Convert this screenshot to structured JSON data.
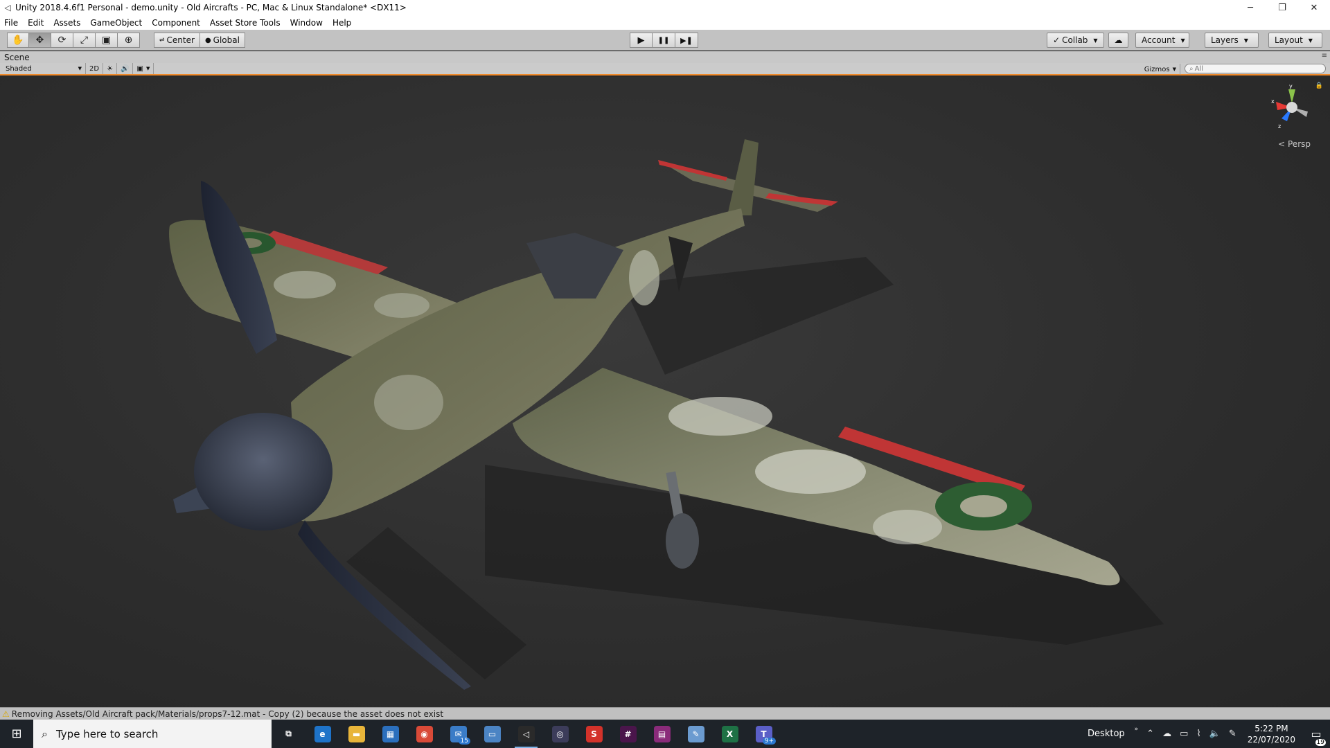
{
  "window": {
    "title": "Unity 2018.4.6f1 Personal - demo.unity - Old Aircrafts - PC, Mac & Linux Standalone* <DX11>",
    "controls": [
      "─",
      "❐",
      "✕"
    ]
  },
  "menubar": {
    "items": [
      "File",
      "Edit",
      "Assets",
      "GameObject",
      "Component",
      "Asset Store Tools",
      "Window",
      "Help"
    ]
  },
  "toolbar": {
    "tools": [
      {
        "name": "hand-tool",
        "glyph": "✋"
      },
      {
        "name": "move-tool",
        "glyph": "✥"
      },
      {
        "name": "rotate-tool",
        "glyph": "⟳"
      },
      {
        "name": "scale-tool",
        "glyph": "⤢"
      },
      {
        "name": "rect-tool",
        "glyph": "▣"
      },
      {
        "name": "transform-tool",
        "glyph": "⊕"
      }
    ],
    "pivot_label": "Center",
    "space_label": "Global",
    "play_glyph": "▶",
    "pause_glyph": "❚❚",
    "step_glyph": "▶❚",
    "collab_label": "Collab",
    "account_label": "Account",
    "layers_label": "Layers",
    "layout_label": "Layout"
  },
  "scene": {
    "tab_label": "Scene",
    "draw_mode": "Shaded",
    "mode_2d": "2D",
    "gizmos_label": "Gizmos",
    "search_placeholder": "All",
    "persp_label": "Persp",
    "axis_y": "y",
    "axis_x": "x",
    "axis_z": "z"
  },
  "status": {
    "message": "Removing Assets/Old Aircraft pack/Materials/props7-12.mat - Copy (2) because the asset does not exist"
  },
  "taskbar": {
    "search_placeholder": "Type here to search",
    "apps": [
      {
        "name": "task-view-icon",
        "glyph": "⧉",
        "color": "transparent",
        "running": false
      },
      {
        "name": "edge-icon",
        "glyph": "e",
        "color": "#1e73c8",
        "running": false
      },
      {
        "name": "file-explorer-icon",
        "glyph": "▬",
        "color": "#e8b53a",
        "running": false
      },
      {
        "name": "store-icon",
        "glyph": "▦",
        "color": "#2b6fbd",
        "running": false
      },
      {
        "name": "chrome-icon",
        "glyph": "◉",
        "color": "#d94a38",
        "running": false
      },
      {
        "name": "mail-icon",
        "glyph": "✉",
        "color": "#3a7cc7",
        "running": false,
        "badge": "15"
      },
      {
        "name": "remote-desktop-icon",
        "glyph": "▭",
        "color": "#4b84c4",
        "running": false
      },
      {
        "name": "unity-icon",
        "glyph": "◁",
        "color": "#2a2a2a",
        "running": true
      },
      {
        "name": "obs-icon",
        "glyph": "◎",
        "color": "#3c3c5a",
        "running": false
      },
      {
        "name": "app-s-icon",
        "glyph": "S",
        "color": "#d3322a",
        "running": false
      },
      {
        "name": "slack-icon",
        "glyph": "#",
        "color": "#4a154b",
        "running": false
      },
      {
        "name": "winrar-icon",
        "glyph": "▤",
        "color": "#8a2b7a",
        "running": false
      },
      {
        "name": "paint-icon",
        "glyph": "✎",
        "color": "#6b9bd0",
        "running": false
      },
      {
        "name": "excel-icon",
        "glyph": "X",
        "color": "#1e7145",
        "running": false
      },
      {
        "name": "teams-icon",
        "glyph": "T",
        "color": "#5b5fc7",
        "running": false,
        "badge": "9+"
      }
    ],
    "desktop_label": "Desktop",
    "time": "5:22 PM",
    "date": "22/07/2020",
    "notification_count": "19"
  }
}
